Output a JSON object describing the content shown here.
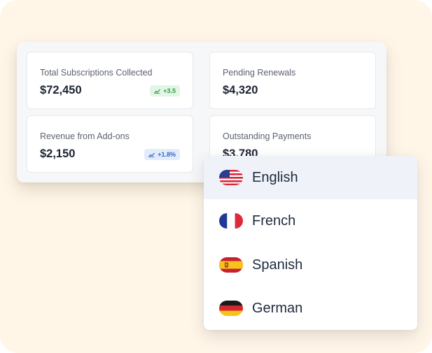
{
  "metrics": [
    {
      "label": "Total Subscriptions Collected",
      "value": "$72,450",
      "badge": "+3.5",
      "badge_color": "green"
    },
    {
      "label": "Pending Renewals",
      "value": "$4,320"
    },
    {
      "label": "Revenue from Add-ons",
      "value": "$2,150",
      "badge": "+1.8%",
      "badge_color": "blue"
    },
    {
      "label": "Outstanding Payments",
      "value": "$3,780"
    }
  ],
  "language_menu": {
    "selected": "English",
    "items": [
      {
        "label": "English",
        "icon": "us-flag-icon"
      },
      {
        "label": "French",
        "icon": "france-flag-icon"
      },
      {
        "label": "Spanish",
        "icon": "spain-flag-icon"
      },
      {
        "label": "German",
        "icon": "germany-flag-icon"
      }
    ]
  },
  "colors": {
    "background": "#fff6e8",
    "badge_green": "#2f9b47",
    "badge_blue": "#3465c7",
    "selected_row": "#eff3f9"
  }
}
